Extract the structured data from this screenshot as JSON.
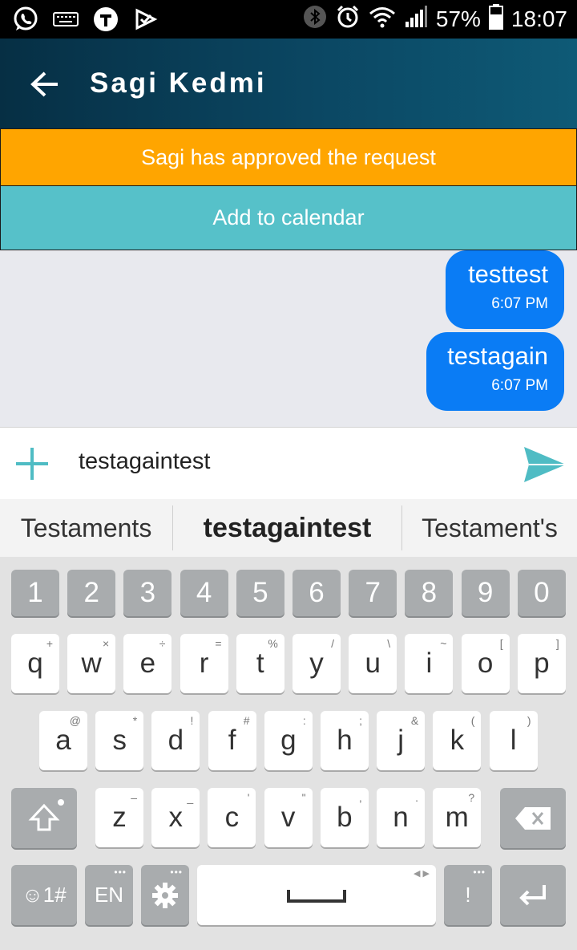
{
  "status_bar": {
    "battery": "57%",
    "time": "18:07",
    "left_icons": [
      "whatsapp-icon",
      "keyboard-icon",
      "t-logo-icon",
      "checkmark-app-icon"
    ],
    "right_icons": [
      "bluetooth-icon",
      "alarm-icon",
      "wifi-icon",
      "signal-icon",
      "battery-icon"
    ]
  },
  "app_bar": {
    "title": "Sagi Kedmi",
    "background": "#0b4763"
  },
  "banners": {
    "approved": "Sagi has approved the request",
    "calendar": "Add to calendar",
    "approved_color": "#ffa500",
    "calendar_color": "#56c1c9"
  },
  "messages": [
    {
      "text": "testtest",
      "time": "6:07 PM"
    },
    {
      "text": "testagain",
      "time": "6:07 PM"
    }
  ],
  "composer": {
    "value": "testagaintest",
    "accent": "#4fbcc4"
  },
  "suggestions": [
    "Testaments",
    "testagaintest",
    "Testament's"
  ],
  "keyboard": {
    "numbers": [
      "1",
      "2",
      "3",
      "4",
      "5",
      "6",
      "7",
      "8",
      "9",
      "0"
    ],
    "row1": [
      {
        "k": "q",
        "s": "+"
      },
      {
        "k": "w",
        "s": "×"
      },
      {
        "k": "e",
        "s": "÷"
      },
      {
        "k": "r",
        "s": "="
      },
      {
        "k": "t",
        "s": "%"
      },
      {
        "k": "y",
        "s": "/"
      },
      {
        "k": "u",
        "s": "\\"
      },
      {
        "k": "i",
        "s": "~"
      },
      {
        "k": "o",
        "s": "["
      },
      {
        "k": "p",
        "s": "]"
      }
    ],
    "row2": [
      {
        "k": "a",
        "s": "@"
      },
      {
        "k": "s",
        "s": "*"
      },
      {
        "k": "d",
        "s": "!"
      },
      {
        "k": "f",
        "s": "#"
      },
      {
        "k": "g",
        "s": ":"
      },
      {
        "k": "h",
        "s": ";"
      },
      {
        "k": "j",
        "s": "&"
      },
      {
        "k": "k",
        "s": "("
      },
      {
        "k": "l",
        "s": ")"
      }
    ],
    "row3": [
      {
        "k": "z",
        "s": "–"
      },
      {
        "k": "x",
        "s": "_"
      },
      {
        "k": "c",
        "s": "'"
      },
      {
        "k": "v",
        "s": "\""
      },
      {
        "k": "b",
        "s": ","
      },
      {
        "k": "n",
        "s": "."
      },
      {
        "k": "m",
        "s": "?"
      }
    ],
    "symbols_label": "☺1#",
    "lang_label": "EN",
    "punct_label": "!"
  }
}
